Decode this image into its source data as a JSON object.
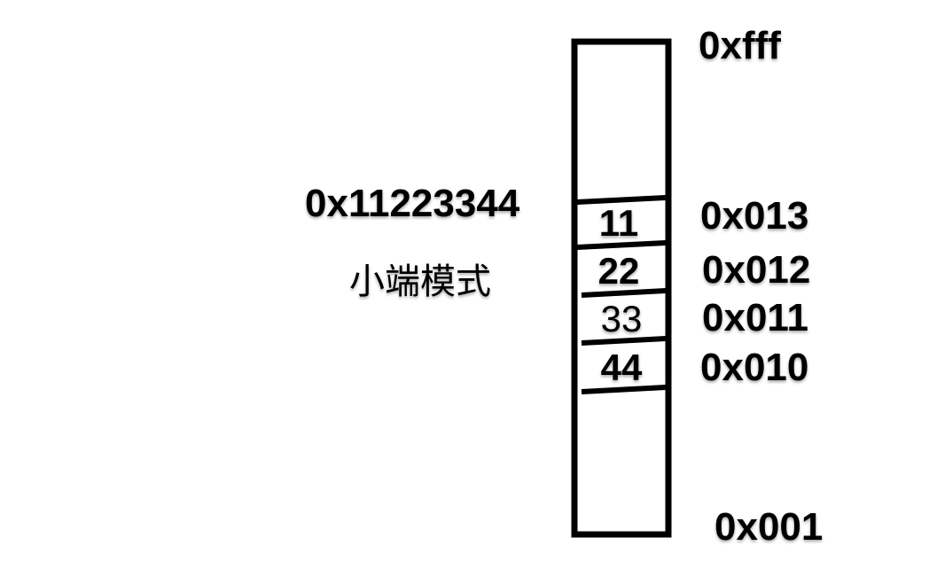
{
  "diagram": {
    "value": "0x11223344",
    "mode_label": "小端模式",
    "top_address": "0xfff",
    "bottom_address": "0x001",
    "cells": [
      {
        "byte": "11",
        "address": "0x013"
      },
      {
        "byte": "22",
        "address": "0x012"
      },
      {
        "byte": "33",
        "address": "0x011"
      },
      {
        "byte": "44",
        "address": "0x010"
      }
    ]
  }
}
